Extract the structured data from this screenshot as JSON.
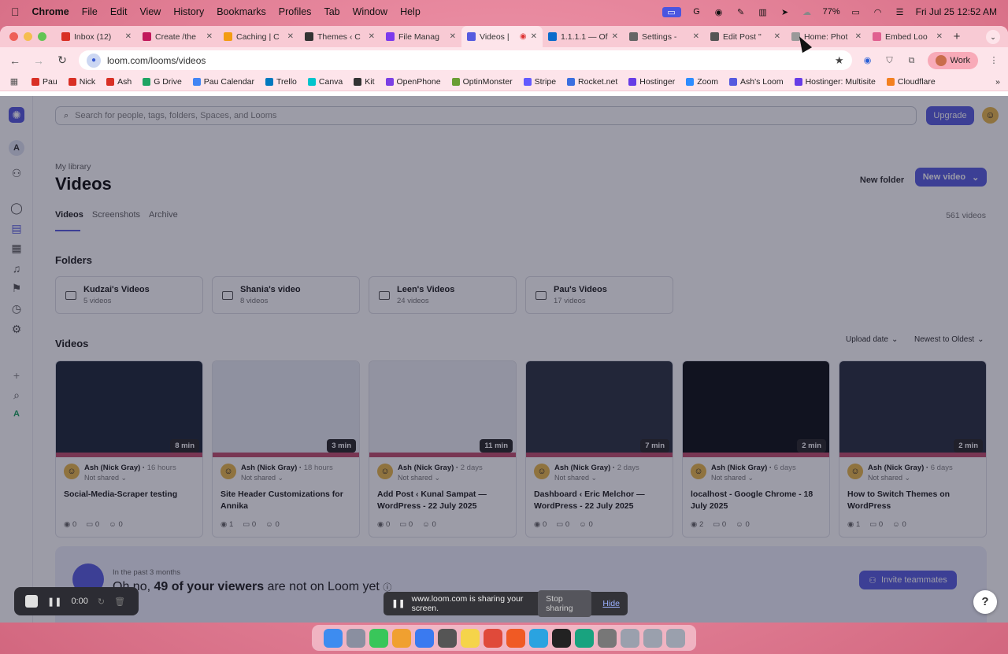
{
  "menubar": {
    "app": "Chrome",
    "menus": [
      "File",
      "Edit",
      "View",
      "History",
      "Bookmarks",
      "Profiles",
      "Tab",
      "Window",
      "Help"
    ],
    "battery": "77%",
    "datetime": "Fri Jul 25  12:52 AM"
  },
  "tabs": [
    {
      "label": "Inbox (12)",
      "color": "#d93025"
    },
    {
      "label": "Create /the",
      "color": "#c2185b"
    },
    {
      "label": "Caching | C",
      "color": "#f39c12"
    },
    {
      "label": "Themes ‹ C",
      "color": "#333333"
    },
    {
      "label": "File Manag",
      "color": "#7c3aed"
    },
    {
      "label": "Videos |",
      "color": "#565adf"
    },
    {
      "label": "1.1.1.1 — Of",
      "color": "#0b6bcb"
    },
    {
      "label": "Settings - ",
      "color": "#666666"
    },
    {
      "label": "Edit Post \"",
      "color": "#555555"
    },
    {
      "label": "Home: Phot",
      "color": "#999999"
    },
    {
      "label": "Embed Loo",
      "color": "#e06090"
    }
  ],
  "active_tab_index": 5,
  "address": {
    "url": "loom.com/looms/videos"
  },
  "profile": {
    "label": "Work"
  },
  "bookmarks": [
    {
      "label": "Pau",
      "color": "#d93025"
    },
    {
      "label": "Nick",
      "color": "#d93025"
    },
    {
      "label": "Ash",
      "color": "#d93025"
    },
    {
      "label": "G Drive",
      "color": "#1fa463"
    },
    {
      "label": "Pau Calendar",
      "color": "#4285f4"
    },
    {
      "label": "Trello",
      "color": "#0079bf"
    },
    {
      "label": "Canva",
      "color": "#00c4cc"
    },
    {
      "label": "Kit",
      "color": "#333333"
    },
    {
      "label": "OpenPhone",
      "color": "#7b3fe4"
    },
    {
      "label": "OptinMonster",
      "color": "#6a9e34"
    },
    {
      "label": "Stripe",
      "color": "#635bff"
    },
    {
      "label": "Rocket.net",
      "color": "#3b6fe0"
    },
    {
      "label": "Hostinger",
      "color": "#673de6"
    },
    {
      "label": "Zoom",
      "color": "#2d8cff"
    },
    {
      "label": "Ash's Loom",
      "color": "#565adf"
    },
    {
      "label": "Hostinger: Multisite",
      "color": "#673de6"
    },
    {
      "label": "Cloudflare",
      "color": "#f38020"
    }
  ],
  "loom": {
    "search_placeholder": "Search for people, tags, folders, Spaces, and Looms",
    "upgrade": "Upgrade",
    "breadcrumb": "My library",
    "page_title": "Videos",
    "new_folder": "New folder",
    "new_video": "New video",
    "lib_tabs": [
      "Videos",
      "Screenshots",
      "Archive"
    ],
    "video_count": "561 videos",
    "folders_heading": "Folders",
    "folders": [
      {
        "name": "Kudzai's Videos",
        "count": "5 videos"
      },
      {
        "name": "Shania's video",
        "count": "8 videos"
      },
      {
        "name": "Leen's Videos",
        "count": "24 videos"
      },
      {
        "name": "Pau's Videos",
        "count": "17 videos"
      }
    ],
    "videos_heading": "Videos",
    "sort_field": "Upload date",
    "sort_order": "Newest to Oldest",
    "videos": [
      {
        "author": "Ash (Nick Gray)",
        "ago": "16 hours",
        "shared": "Not shared",
        "title": "Social-Media-Scraper testing",
        "duration": "8 min",
        "views": "0",
        "comments": "0",
        "reactions": "0",
        "bg": "#1f2a3a"
      },
      {
        "author": "Ash (Nick Gray)",
        "ago": "18 hours",
        "shared": "Not shared",
        "title": "Site Header Customizations for Annika",
        "duration": "3 min",
        "views": "1",
        "comments": "0",
        "reactions": "0",
        "bg": "#e9ecf3"
      },
      {
        "author": "Ash (Nick Gray)",
        "ago": "2 days",
        "shared": "Not shared",
        "title": "Add Post ‹ Kunal Sampat — WordPress - 22 July 2025",
        "duration": "11 min",
        "views": "0",
        "comments": "0",
        "reactions": "0",
        "bg": "#eef0f5"
      },
      {
        "author": "Ash (Nick Gray)",
        "ago": "2 days",
        "shared": "Not shared",
        "title": "Dashboard ‹ Eric Melchor — WordPress - 22 July 2025",
        "duration": "7 min",
        "views": "0",
        "comments": "0",
        "reactions": "0",
        "bg": "#2d3442"
      },
      {
        "author": "Ash (Nick Gray)",
        "ago": "6 days",
        "shared": "Not shared",
        "title": "localhost - Google Chrome - 18 July 2025",
        "duration": "2 min",
        "views": "2",
        "comments": "0",
        "reactions": "0",
        "bg": "#111318"
      },
      {
        "author": "Ash (Nick Gray)",
        "ago": "6 days",
        "shared": "Not shared",
        "title": "How to Switch Themes on WordPress",
        "duration": "2 min",
        "views": "1",
        "comments": "0",
        "reactions": "0",
        "bg": "#2a3140"
      }
    ],
    "banner": {
      "sub": "In the past 3 months",
      "msg_pre": "Oh no, ",
      "msg_bold": "49 of your viewers",
      "msg_post": " are not on Loom yet",
      "invite": "Invite teammates"
    }
  },
  "recorder": {
    "time": "0:00"
  },
  "share_bar": {
    "text": "www.loom.com is sharing your screen.",
    "stop": "Stop sharing",
    "hide": "Hide"
  },
  "dock_icons": [
    {
      "name": "finder-icon",
      "color": "#3d8cf0"
    },
    {
      "name": "launchpad-icon",
      "color": "#8a8fa0"
    },
    {
      "name": "messages-icon",
      "color": "#39c65a"
    },
    {
      "name": "photos-icon",
      "color": "#f0a030"
    },
    {
      "name": "notes-app-icon",
      "color": "#3a7af0"
    },
    {
      "name": "calculator-icon",
      "color": "#555555"
    },
    {
      "name": "notes-icon",
      "color": "#f5d44a"
    },
    {
      "name": "chrome-icon",
      "color": "#e04a3a"
    },
    {
      "name": "brave-icon",
      "color": "#f05a24"
    },
    {
      "name": "telegram-icon",
      "color": "#2aa3e0"
    },
    {
      "name": "cursor-app-icon",
      "color": "#222222"
    },
    {
      "name": "chatgpt-icon",
      "color": "#19a37f"
    },
    {
      "name": "settings-icon",
      "color": "#777777"
    },
    {
      "name": "folder-icon",
      "color": "#9aa0ad"
    },
    {
      "name": "downloads-icon",
      "color": "#9aa0ad"
    },
    {
      "name": "trash-icon",
      "color": "#9aa0ad"
    }
  ]
}
